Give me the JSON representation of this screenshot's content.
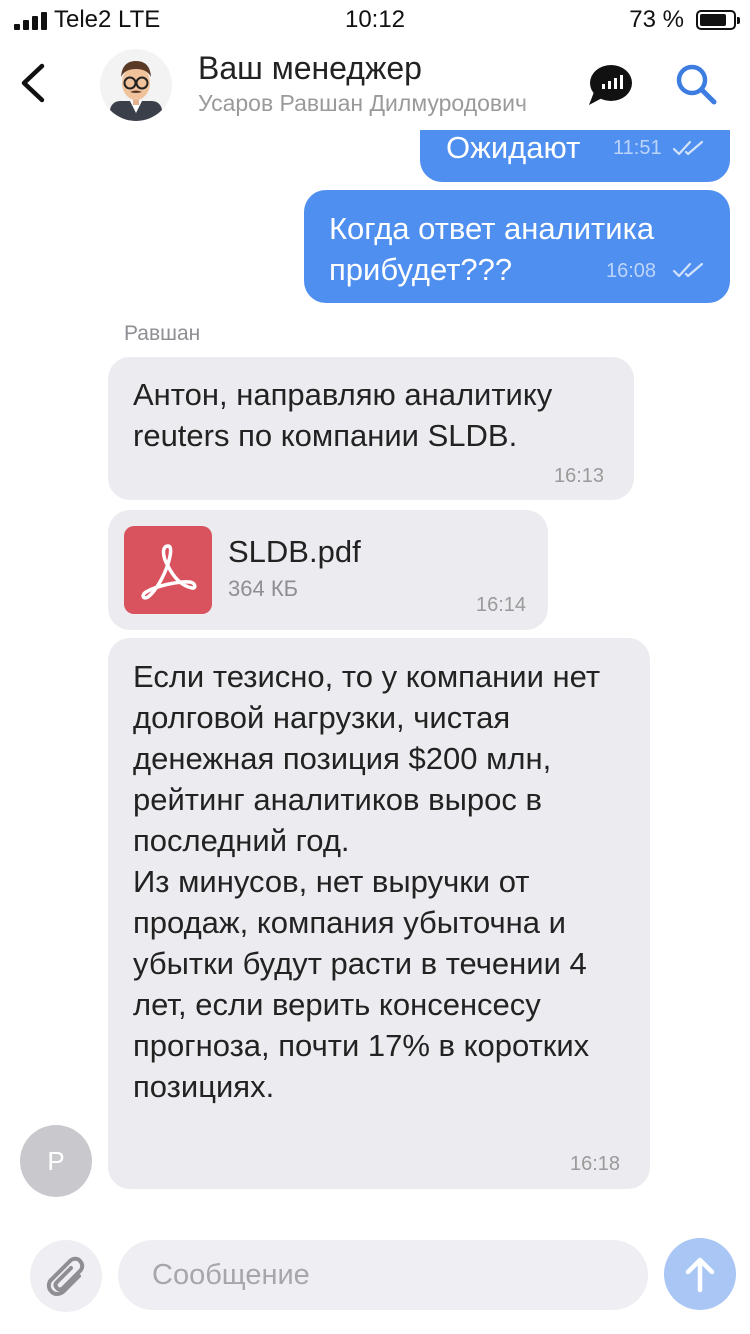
{
  "status_bar": {
    "carrier": "Tele2",
    "network": "LTE",
    "time": "10:12",
    "battery_percent": "73 %",
    "battery_level": 0.73
  },
  "header": {
    "title": "Ваш менеджер",
    "subtitle": "Усаров Равшан Дилмуродович",
    "icons": [
      "back-chevron-icon",
      "avatar-illustration",
      "chat-bubble-icon",
      "search-icon"
    ]
  },
  "colors": {
    "accent": "#3d7de2",
    "outgoing_bubble": "#4f8ff0",
    "incoming_bubble": "#ececf0",
    "pdf_tile": "#d9535f"
  },
  "messages": [
    {
      "direction": "out",
      "text": "Ожидают",
      "time": "11:51",
      "read": true
    },
    {
      "direction": "out",
      "text": "Когда ответ аналитика прибудет???",
      "time": "16:08",
      "read": true
    },
    {
      "direction": "in",
      "sender": "Равшан",
      "text": "Антон, направляю аналитику reuters по компании SLDB.",
      "time": "16:13"
    },
    {
      "direction": "in",
      "type": "file",
      "file_name": "SLDB.pdf",
      "file_size": "364 КБ",
      "time": "16:14"
    },
    {
      "direction": "in",
      "text": "Если тезисно, то у компании нет долговой нагрузки, чистая денежная позиция $200 млн, рейтинг аналитиков вырос в последний год.\nИз минусов, нет выручки от продаж, компания убыточна и убытки будут расти в течении 4 лет, если верить консенсесу прогноза, почти 17% в коротких позициях.",
      "time": "16:18"
    }
  ],
  "sender_avatar_letter": "Р",
  "composer": {
    "placeholder": "Сообщение",
    "value": ""
  }
}
